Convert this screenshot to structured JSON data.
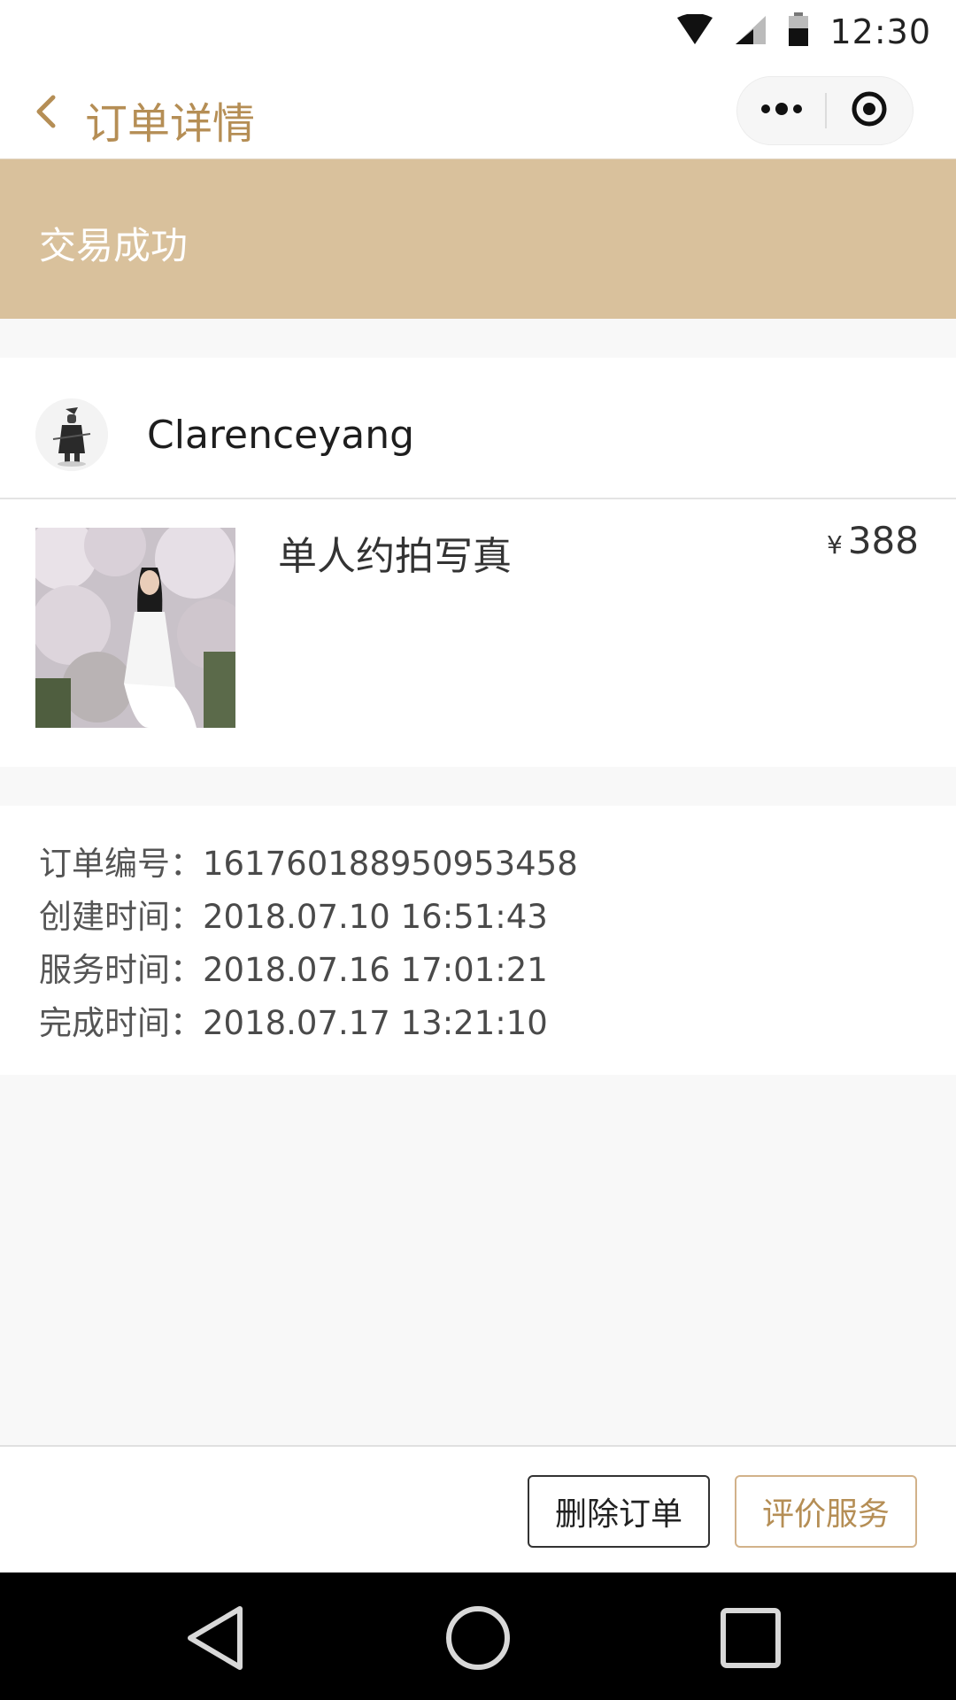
{
  "status_bar": {
    "time": "12:30",
    "icons": [
      "wifi-icon",
      "signal-icon",
      "battery-icon"
    ]
  },
  "nav": {
    "title": "订单详情",
    "back_icon": "chevron-left-icon",
    "menu_icons": [
      "more-dots-icon",
      "target-icon"
    ]
  },
  "order_status": {
    "text": "交易成功"
  },
  "seller": {
    "name": "Clarenceyang",
    "avatar_icon": "avatar-image"
  },
  "product": {
    "title": "单人约拍写真",
    "currency": "¥",
    "price": "388",
    "image_icon": "product-photo"
  },
  "order_info": {
    "order_no_label": "订单编号：",
    "order_no": "161760188950953458",
    "created_label": "创建时间：",
    "created": "2018.07.10 16:51:43",
    "service_label": "服务时间：",
    "service": "2018.07.16 17:01:21",
    "completed_label": "完成时间：",
    "completed": "2018.07.17 13:21:10"
  },
  "actions": {
    "delete_label": "删除订单",
    "review_label": "评价服务"
  },
  "system_nav": {
    "icons": [
      "back-triangle-icon",
      "home-circle-icon",
      "recents-square-icon"
    ]
  },
  "colors": {
    "accent": "#b58e55",
    "banner": "#d9c19c",
    "page_bg": "#f8f8f8"
  }
}
